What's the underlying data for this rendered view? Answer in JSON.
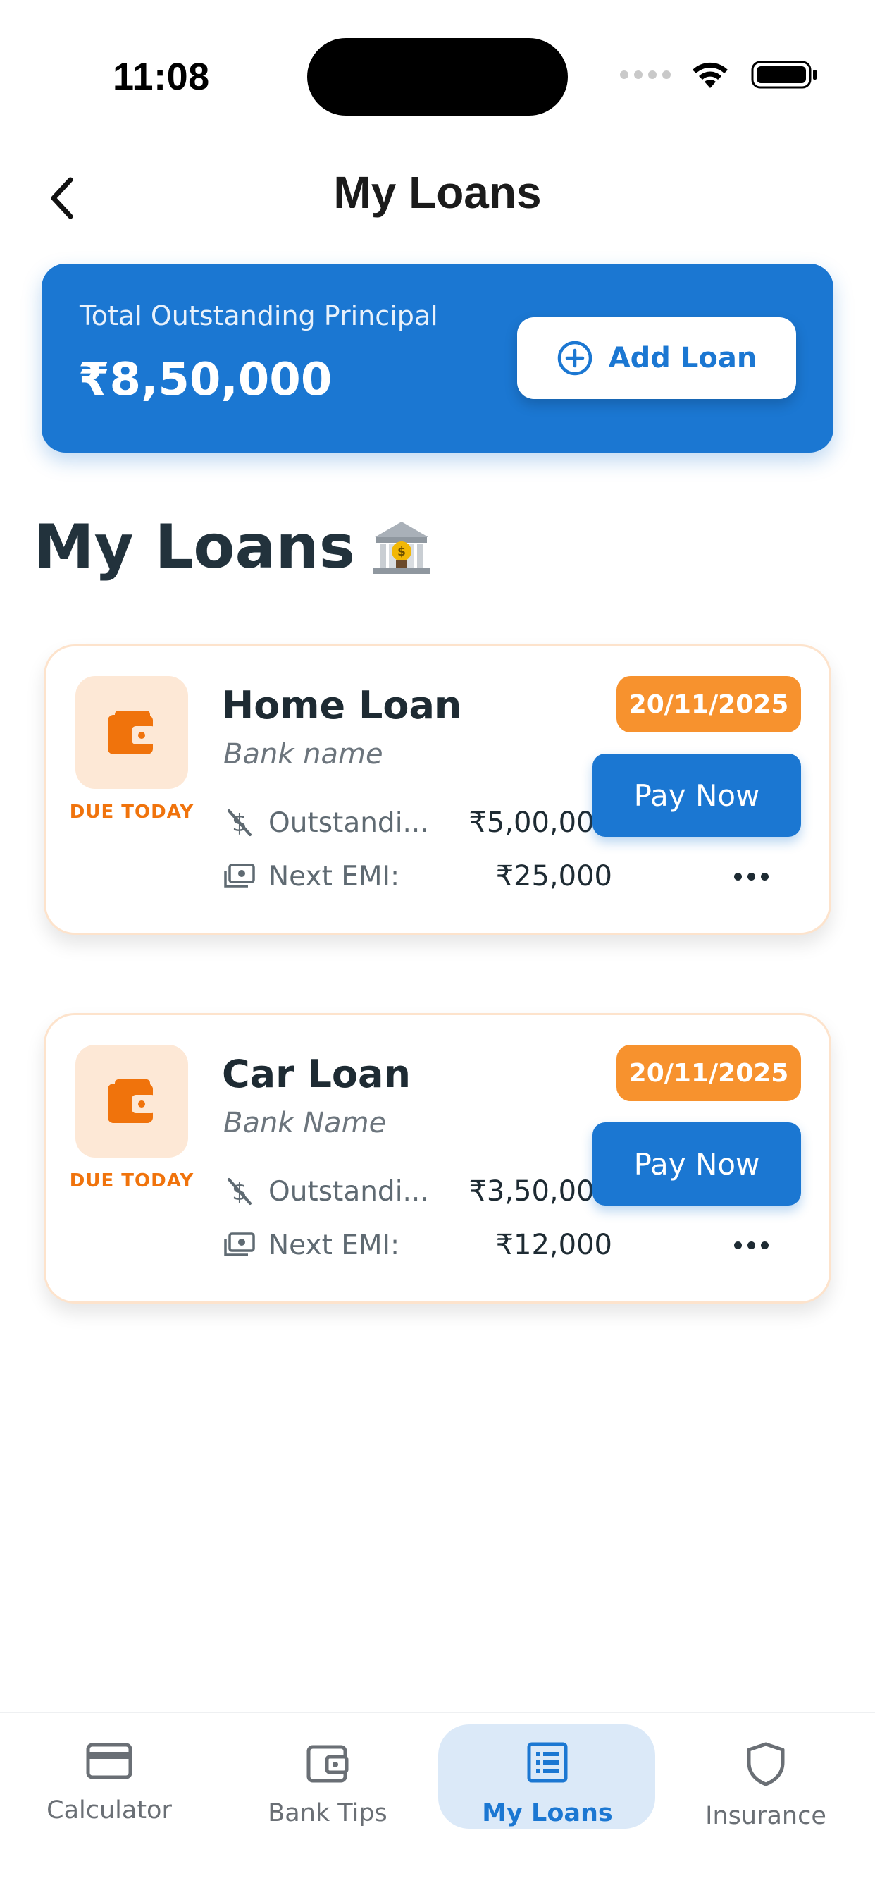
{
  "status_bar": {
    "time": "11:08"
  },
  "header": {
    "title": "My Loans",
    "back_icon": "chevron-left-icon"
  },
  "summary": {
    "label": "Total Outstanding Principal",
    "amount": "₹8,50,000",
    "add_button_label": "Add Loan",
    "add_button_icon": "plus-circle-icon"
  },
  "section": {
    "title": "My Loans",
    "emoji": "🏦"
  },
  "loans": [
    {
      "name": "Home Loan",
      "bank": "Bank name",
      "due_label": "DUE TODAY",
      "date": "20/11/2025",
      "outstanding_label": "Outstandi...",
      "outstanding_value": "₹5,00,000",
      "emi_label": "Next EMI:",
      "emi_value": "₹25,000",
      "pay_label": "Pay Now"
    },
    {
      "name": "Car Loan",
      "bank": "Bank Name",
      "due_label": "DUE TODAY",
      "date": "20/11/2025",
      "outstanding_label": "Outstandi...",
      "outstanding_value": "₹3,50,000",
      "emi_label": "Next EMI:",
      "emi_value": "₹12,000",
      "pay_label": "Pay Now"
    }
  ],
  "tabbar": {
    "tabs": [
      {
        "label": "Calculator",
        "icon": "credit-card-icon"
      },
      {
        "label": "Bank Tips",
        "icon": "wallet-icon"
      },
      {
        "label": "My Loans",
        "icon": "list-icon",
        "active": true
      },
      {
        "label": "Insurance",
        "icon": "shield-icon"
      }
    ]
  },
  "colors": {
    "primary": "#1b77d2",
    "accent_orange": "#f7922e",
    "due_orange": "#f0730c",
    "tab_active_bg": "#dbe9f8"
  }
}
